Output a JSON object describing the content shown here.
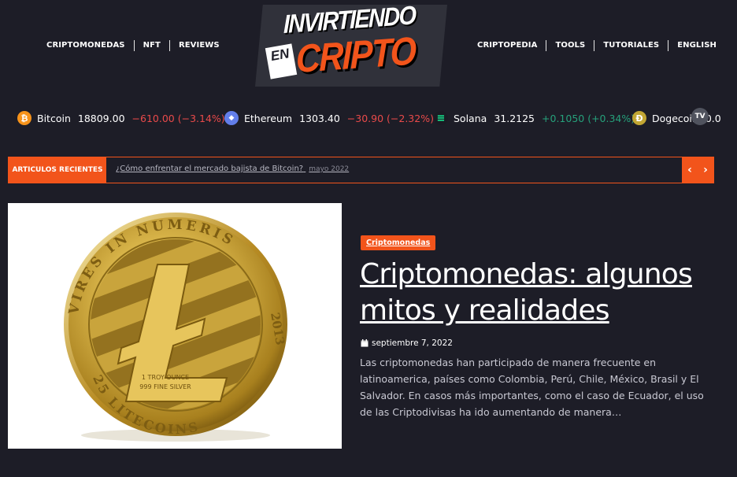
{
  "nav": {
    "left": [
      "CRIPTOMONEDAS",
      "NFT",
      "REVIEWS"
    ],
    "right": [
      "CRIPTOPEDIA",
      "TOOLS",
      "TUTORIALES",
      "ENGLISH"
    ]
  },
  "logo": {
    "line1": "INVIRTIENDO",
    "en": "EN",
    "line2": "CRIPTO"
  },
  "ticker": [
    {
      "name": "Bitcoin",
      "price": "18809.00",
      "change": "−610.00 (−3.14%)",
      "direction": "down",
      "icon": "bitcoin-icon",
      "symbol": "₿",
      "color": "#f7931a"
    },
    {
      "name": "Ethereum",
      "price": "1303.40",
      "change": "−30.90 (−2.32%)",
      "direction": "down",
      "icon": "ethereum-icon",
      "symbol": "◆",
      "color": "#627eea"
    },
    {
      "name": "Solana",
      "price": "31.2125",
      "change": "+0.1050 (+0.34%)",
      "direction": "up",
      "icon": "solana-icon",
      "symbol": "≡",
      "color": "#1b1b24"
    },
    {
      "name": "Dogecoin",
      "price": "0.0",
      "change": "",
      "direction": "up",
      "icon": "dogecoin-icon",
      "symbol": "Đ",
      "color": "#c2a633"
    }
  ],
  "tv_badge": "TV",
  "recent": {
    "label": "ARTICULOS RECIENTES",
    "headline": "¿Cómo enfrentar el mercado bajista de Bitcoin?",
    "date": "mayo 2022",
    "prev": "‹",
    "next": "›"
  },
  "article": {
    "category": "Criptomonedas",
    "title": "Criptomonedas: algunos mitos y realidades",
    "date": "septiembre 7, 2022",
    "excerpt": "Las criptomonedas han participado de manera frecuente en latinoamerica, países como Colombia, Perú, Chile, México, Brasil y El Salvador. En casos más importantes, como el caso de Ecuador, el uso de las Criptodivisas ha ido aumentando de manera…"
  },
  "coin_image": {
    "ring_top": "VIRES IN NUMERIS",
    "year": "2013",
    "ring_bottom": "25 LITECOINS",
    "center_small1": "1 TROY OUNCE",
    "center_small2": "999 FINE SILVER"
  },
  "colors": {
    "accent": "#f2541b",
    "background": "#1d1d27",
    "negative": "#e94a4a",
    "positive": "#26a17b"
  }
}
